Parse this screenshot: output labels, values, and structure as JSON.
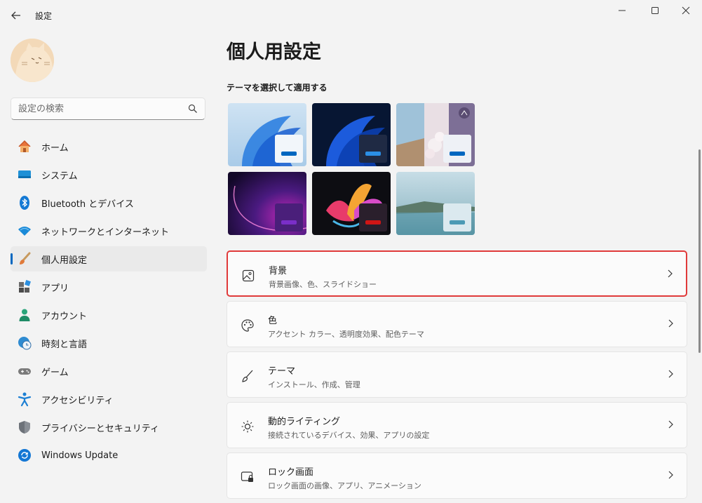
{
  "window": {
    "app_title": "設定"
  },
  "search": {
    "placeholder": "設定の検索"
  },
  "sidebar": {
    "items": [
      {
        "label": "ホーム"
      },
      {
        "label": "システム"
      },
      {
        "label": "Bluetooth とデバイス"
      },
      {
        "label": "ネットワークとインターネット"
      },
      {
        "label": "個人用設定"
      },
      {
        "label": "アプリ"
      },
      {
        "label": "アカウント"
      },
      {
        "label": "時刻と言語"
      },
      {
        "label": "ゲーム"
      },
      {
        "label": "アクセシビリティ"
      },
      {
        "label": "プライバシーとセキュリティ"
      },
      {
        "label": "Windows Update"
      }
    ],
    "active_item": "個人用設定"
  },
  "main": {
    "title": "個人用設定",
    "theme_section_label": "テーマを選択して適用する",
    "themes": [
      {
        "name": "windows-light"
      },
      {
        "name": "windows-dark"
      },
      {
        "name": "glow-flowers"
      },
      {
        "name": "sunrise"
      },
      {
        "name": "flow"
      },
      {
        "name": "captured-motion-lake"
      }
    ],
    "cards": [
      {
        "title": "背景",
        "subtitle": "背景画像、色、スライドショー",
        "icon": "image-icon"
      },
      {
        "title": "色",
        "subtitle": "アクセント カラー、透明度効果、配色テーマ",
        "icon": "palette-icon"
      },
      {
        "title": "テーマ",
        "subtitle": "インストール、作成、管理",
        "icon": "brush-icon"
      },
      {
        "title": "動的ライティング",
        "subtitle": "接続されているデバイス、効果、アプリの設定",
        "icon": "dynamic-lighting-icon"
      },
      {
        "title": "ロック画面",
        "subtitle": "ロック画面の画像、アプリ、アニメーション",
        "icon": "lock-screen-icon"
      }
    ]
  },
  "colors": {
    "accent": "#0067c0",
    "highlight_border": "#e03a3a"
  }
}
